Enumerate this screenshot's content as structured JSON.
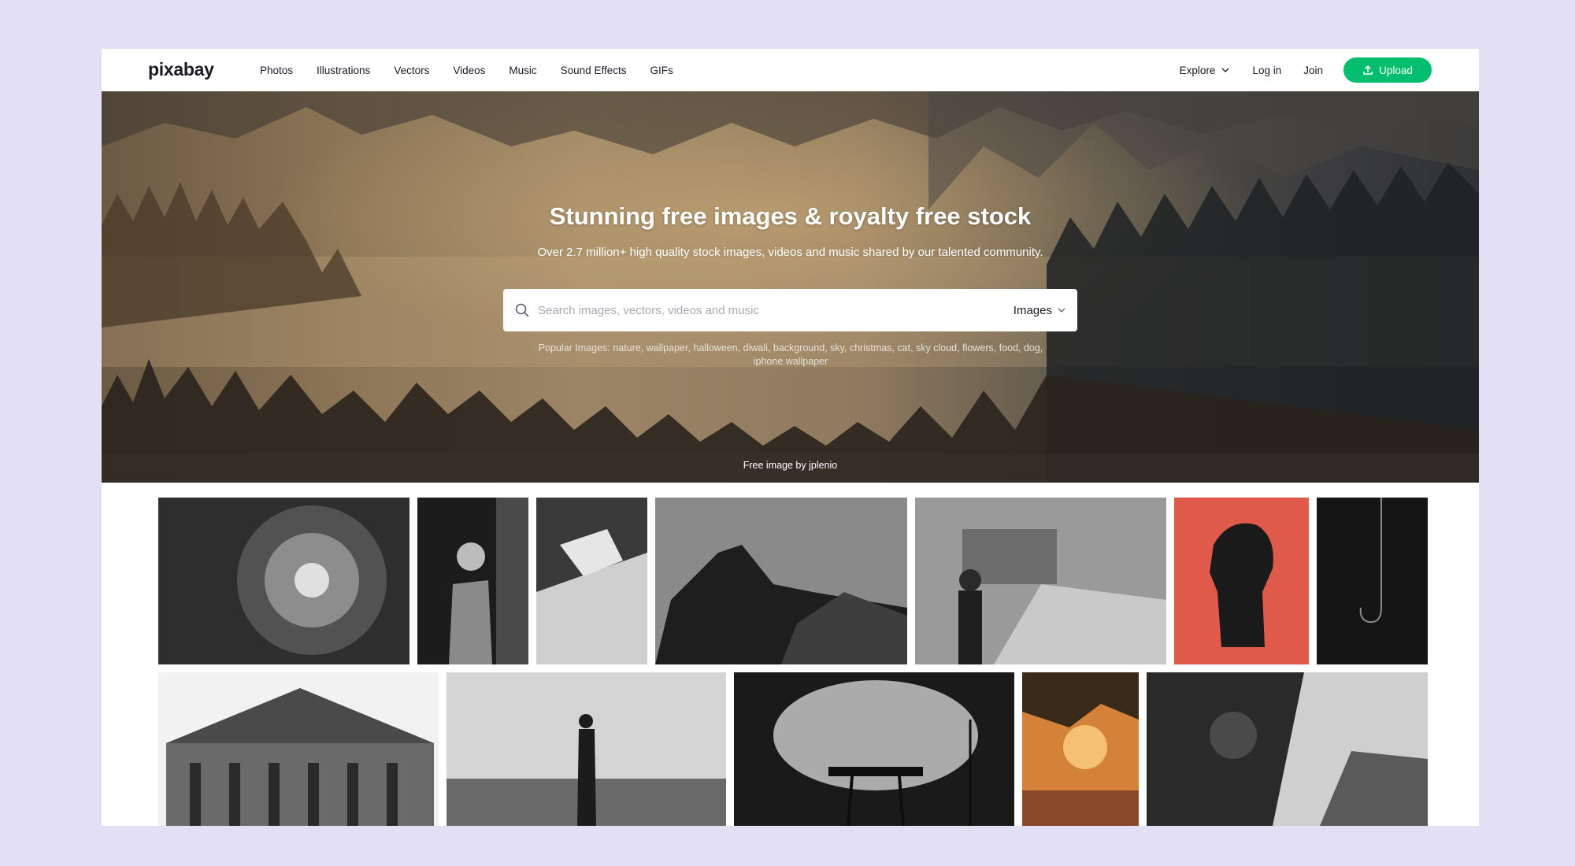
{
  "header": {
    "logo": "pixabay",
    "nav": [
      "Photos",
      "Illustrations",
      "Vectors",
      "Videos",
      "Music",
      "Sound Effects",
      "GIFs"
    ],
    "explore": "Explore",
    "login": "Log in",
    "join": "Join",
    "upload": "Upload"
  },
  "hero": {
    "title": "Stunning free images & royalty free stock",
    "subtitle": "Over 2.7 million+ high quality stock images, videos and music shared by our talented community.",
    "search_placeholder": "Search images, vectors, videos and music",
    "search_type": "Images",
    "popular_prefix": "Popular Images:",
    "popular_tags": [
      "nature",
      "wallpaper",
      "halloween",
      "diwali",
      "background",
      "sky",
      "christmas",
      "cat",
      "sky cloud",
      "flowers",
      "food",
      "dog",
      "iphone wallpaper"
    ],
    "credit": "Free image by jplenio"
  },
  "colors": {
    "accent": "#02be6e",
    "page_background": "#e3e0f5",
    "text": "#191b26"
  },
  "icons": {
    "search": "search-icon",
    "chevron": "chevron-down-icon",
    "upload": "upload-icon"
  }
}
